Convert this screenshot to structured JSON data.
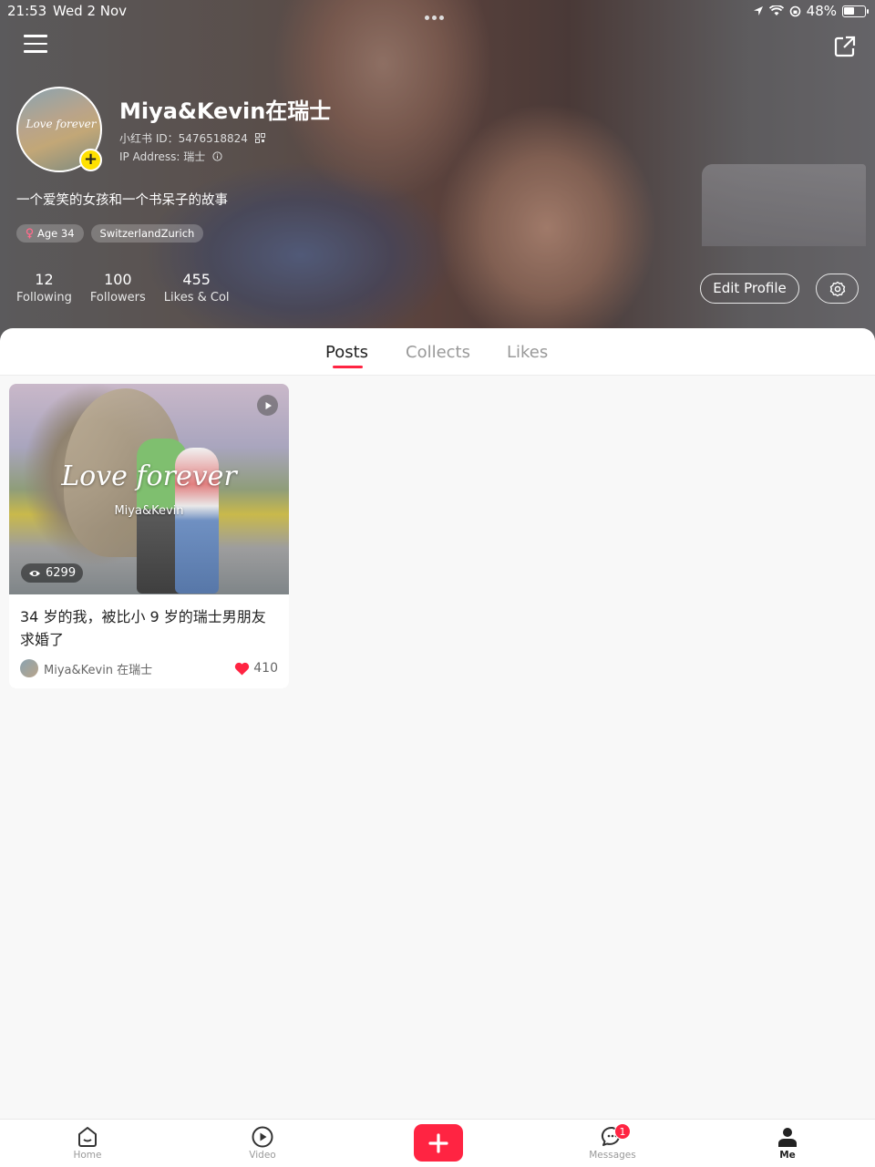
{
  "status_bar": {
    "time": "21:53",
    "date": "Wed 2 Nov",
    "battery": "48%"
  },
  "profile": {
    "avatar_text": "Love forever",
    "username": "Miya&Kevin在瑞士",
    "redbook_id": "小红书 ID：5476518824",
    "ip_address": "IP Address: 瑞士",
    "bio": "一个爱笑的女孩和一个书呆子的故事",
    "tags": [
      {
        "label": "Age 34",
        "icon": "female-icon"
      },
      {
        "label": "SwitzerlandZurich"
      }
    ],
    "stats": [
      {
        "value": "12",
        "label": "Following"
      },
      {
        "value": "100",
        "label": "Followers"
      },
      {
        "value": "455",
        "label": "Likes & Col"
      }
    ],
    "edit_label": "Edit Profile"
  },
  "tabs": [
    "Posts",
    "Collects",
    "Likes"
  ],
  "active_tab": "Posts",
  "posts": [
    {
      "cover_title": "Love forever",
      "cover_subtitle": "Miya&Kevin",
      "views": "6299",
      "caption": "34 岁的我，被比小 9 岁的瑞士男朋友求婚了",
      "author": "Miya&Kevin 在瑞士",
      "likes": "410",
      "type": "video"
    }
  ],
  "bottom_nav": [
    {
      "label": "Home",
      "icon": "home-icon"
    },
    {
      "label": "Video",
      "icon": "play-circle-icon"
    },
    {
      "label": "",
      "icon": "plus-icon"
    },
    {
      "label": "Messages",
      "icon": "chat-bubble-icon",
      "badge": "1"
    },
    {
      "label": "Me",
      "icon": "person-icon",
      "active": true
    }
  ],
  "colors": {
    "accent": "#ff2442",
    "avatar_add": "#ffe100"
  }
}
